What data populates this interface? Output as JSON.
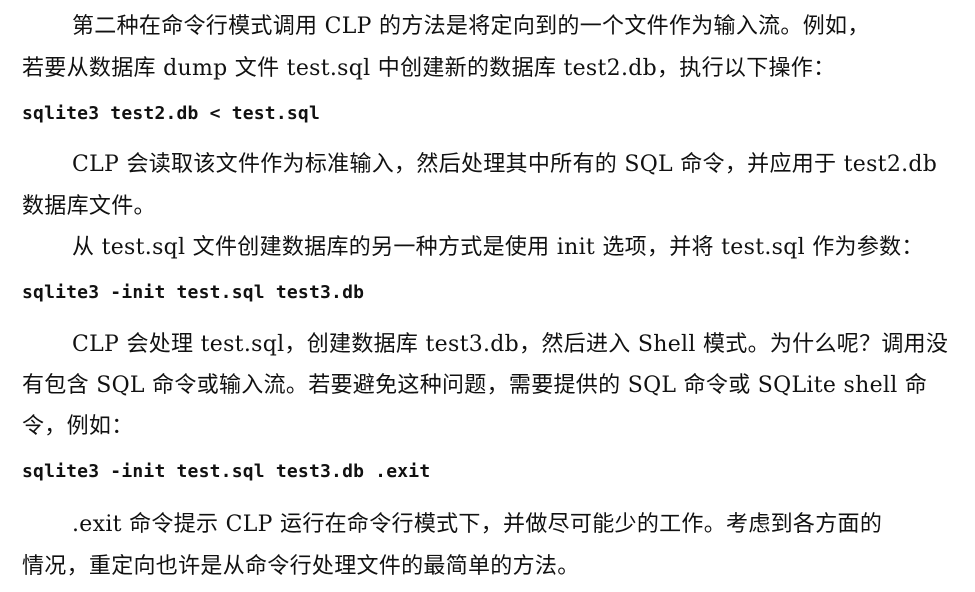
{
  "paragraphs": [
    {
      "lines": [
        "第二种在命令行模式调用 CLP 的方法是将定向到的一个文件作为输入流。例如，",
        "若要从数据库 dump 文件 test.sql 中创建新的数据库 test2.db，执行以下操作："
      ]
    },
    {
      "lines": [
        "CLP 会读取该文件作为标准输入，然后处理其中所有的 SQL 命令，并应用于 test2.db",
        "数据库文件。",
        "从 test.sql 文件创建数据库的另一种方式是使用 init 选项，并将 test.sql 作为参数："
      ]
    },
    {
      "lines": [
        "CLP 会处理 test.sql，创建数据库 test3.db，然后进入 Shell 模式。为什么呢？调用没",
        "有包含 SQL 命令或输入流。若要避免这种问题，需要提供的 SQL 命令或 SQLite shell  命",
        "令，例如："
      ]
    },
    {
      "lines": [
        ".exit 命令提示 CLP 运行在命令行模式下，并做尽可能少的工作。考虑到各方面的",
        "情况，重定向也许是从命令行处理文件的最简单的方法。"
      ]
    }
  ],
  "code_blocks": [
    "sqlite3 test2.db < test.sql",
    "sqlite3 -init test.sql test3.db",
    "sqlite3 -init test.sql test3.db .exit"
  ]
}
